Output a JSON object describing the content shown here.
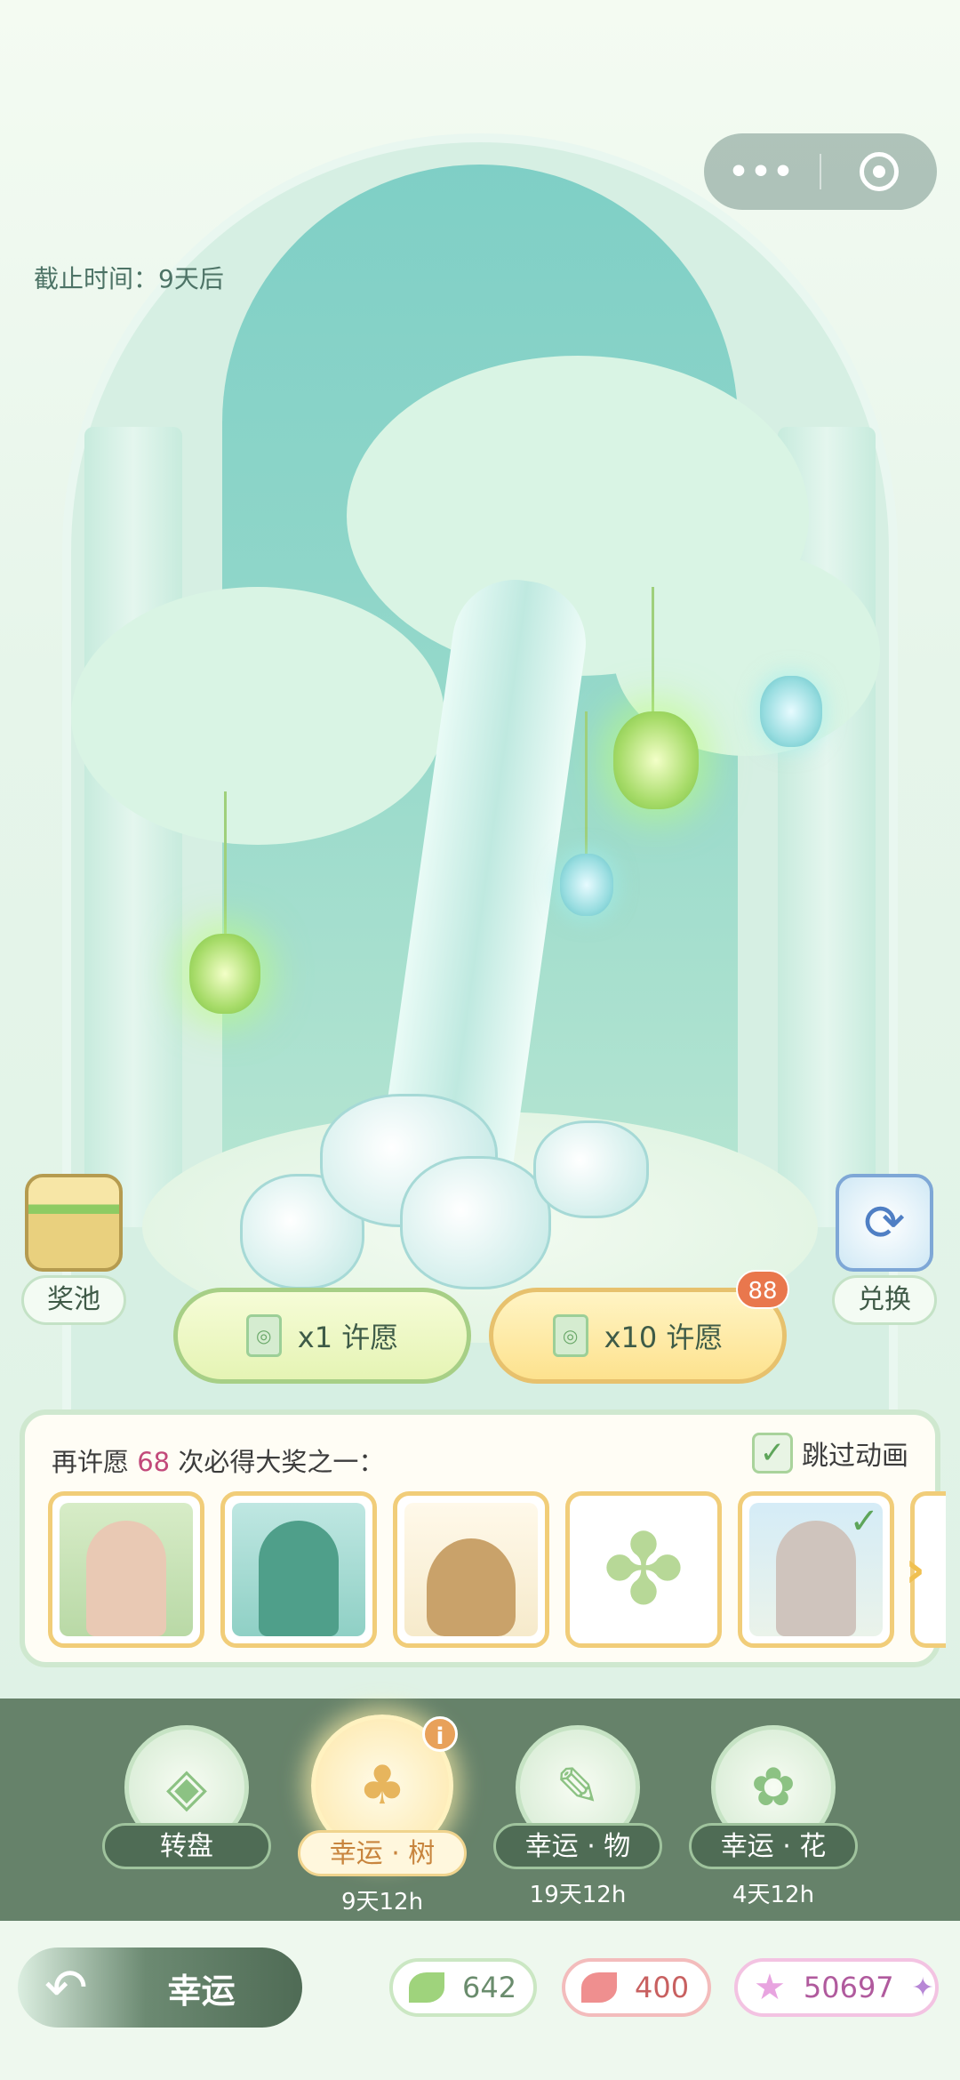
{
  "deadline": "截止时间：9天后",
  "capsule": {
    "more_icon": "more-dots-icon",
    "close_icon": "target-close-icon"
  },
  "side_buttons": {
    "prize_pool": "奖池",
    "exchange": "兑换"
  },
  "wish": {
    "single": "x1 许愿",
    "ten": "x10 许愿",
    "ten_badge": "88"
  },
  "guarantee": {
    "prefix": "再许愿",
    "count": "68",
    "suffix": "次必得大奖之一：",
    "skip_label": "跳过动画"
  },
  "tabs": [
    {
      "label": "转盘",
      "sub": ""
    },
    {
      "label": "幸运 · 树",
      "sub": "9天12h"
    },
    {
      "label": "幸运 · 物",
      "sub": "19天12h"
    },
    {
      "label": "幸运 · 花",
      "sub": "4天12h"
    }
  ],
  "bottom": {
    "back_label": "幸运",
    "leaf_green": "642",
    "leaf_red": "400",
    "stars": "50697"
  },
  "colors": {
    "accent": "#66826a",
    "highlight": "#c2497a",
    "badge": "#e9774d"
  }
}
